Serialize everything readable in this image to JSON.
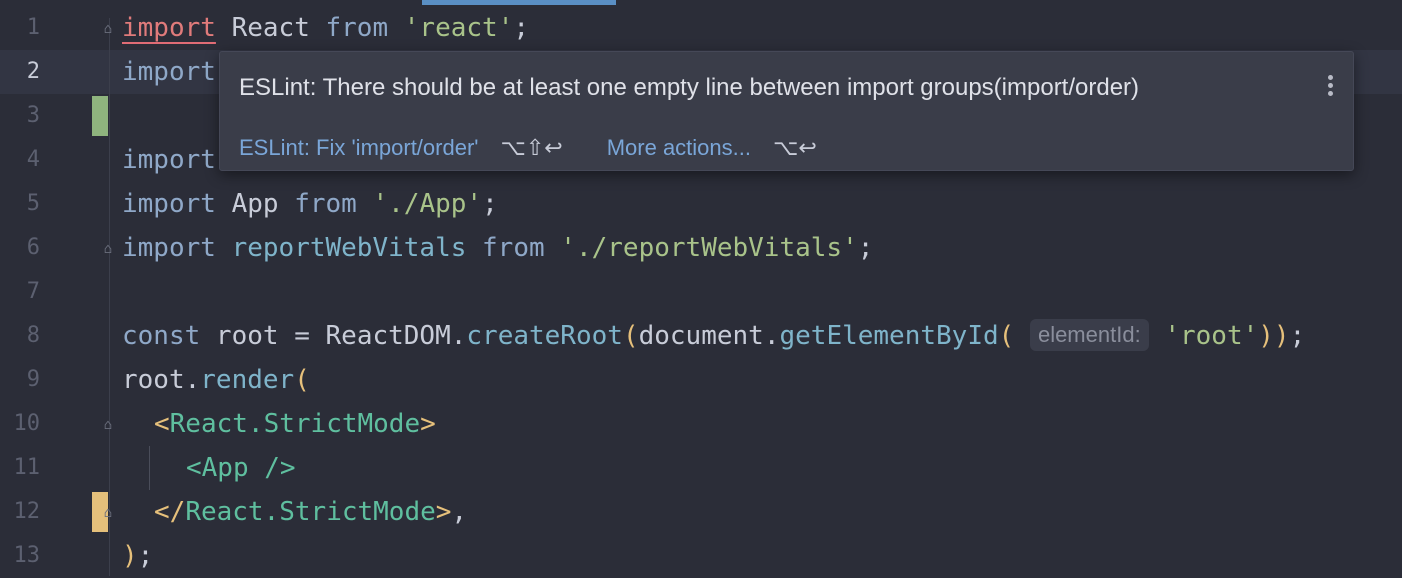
{
  "editor": {
    "lines": [
      {
        "n": "1"
      },
      {
        "n": "2"
      },
      {
        "n": "3"
      },
      {
        "n": "4"
      },
      {
        "n": "5"
      },
      {
        "n": "6"
      },
      {
        "n": "7"
      },
      {
        "n": "8"
      },
      {
        "n": "9"
      },
      {
        "n": "10"
      },
      {
        "n": "11"
      },
      {
        "n": "12"
      },
      {
        "n": "13"
      }
    ],
    "code": {
      "l1_kw": "import",
      "l1_id": " React ",
      "l1_from": "from",
      "l1_str": " 'react'",
      "l1_end": ";",
      "l2_kw": "import",
      "l4_kw": "import",
      "l5_kw": "import",
      "l5_id": " App ",
      "l5_from": "from",
      "l5_str": " './App'",
      "l5_end": ";",
      "l6_kw": "import",
      "l6_id": " reportWebVitals ",
      "l6_from": "from",
      "l6_str": " './reportWebVitals'",
      "l6_end": ";",
      "l8_kw": "const",
      "l8_a": " root = ReactDOM.",
      "l8_fn1": "createRoot",
      "l8_p1": "(",
      "l8_b": "document.",
      "l8_fn2": "getElementById",
      "l8_p2": "( ",
      "l8_hint": "elementId:",
      "l8_str": " 'root'",
      "l8_p3": ")",
      "l8_p4": ")",
      "l8_end": ";",
      "l9_a": "root.",
      "l9_fn": "render",
      "l9_p": "(",
      "l10_lt": "<",
      "l10_tag": "React.StrictMode",
      "l10_gt": ">",
      "l11_tag": "<App />",
      "l12_lt": "</",
      "l12_tag": "React.StrictMode",
      "l12_gt": ">",
      "l12_end": ",",
      "l13_p": ")",
      "l13_end": ";"
    }
  },
  "popup": {
    "message": "ESLint: There should be at least one empty line between import groups(import/order)",
    "fix_action": "ESLint: Fix 'import/order'",
    "fix_shortcut": "⌥⇧↩",
    "more_action": "More actions...",
    "more_shortcut": "⌥↩",
    "menu_icon": "kebab-menu-icon"
  },
  "colors": {
    "background": "#2b2d38",
    "keyword": "#8fa8c8",
    "string": "#a9c38a",
    "error_underline": "#e06c75",
    "added_marker": "#8fb47e",
    "modified_marker": "#e5c07b",
    "link": "#7aa6d8"
  }
}
